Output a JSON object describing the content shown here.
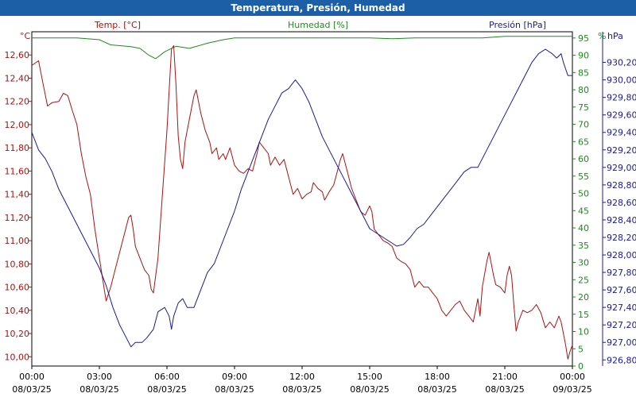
{
  "window": {
    "title": "Temperatura, Presión, Humedad"
  },
  "chart_data": {
    "type": "line",
    "title": "Temperatura, Presión, Humedad",
    "grid": true,
    "x": {
      "min_hour": 0,
      "max_hour": 24,
      "tick_hours": [
        0,
        3,
        6,
        9,
        12,
        15,
        18,
        21,
        24
      ],
      "tick_time_labels": [
        "00:00",
        "03:00",
        "06:00",
        "09:00",
        "12:00",
        "15:00",
        "18:00",
        "21:00",
        "00:00"
      ],
      "tick_date_labels": [
        "08/03/25",
        "08/03/25",
        "08/03/25",
        "08/03/25",
        "08/03/25",
        "08/03/25",
        "08/03/25",
        "08/03/25",
        "09/03/25"
      ]
    },
    "axes": {
      "temp": {
        "unit_label": "°C",
        "legend": "Temp. [°C]",
        "min": 9.92,
        "max": 12.8,
        "ticks": [
          "10,00",
          "10,20",
          "10,40",
          "10,60",
          "10,80",
          "11,00",
          "11,20",
          "11,40",
          "11,60",
          "11,80",
          "12,00",
          "12,20",
          "12,40",
          "12,60"
        ],
        "tick_values": [
          10.0,
          10.2,
          10.4,
          10.6,
          10.8,
          11.0,
          11.2,
          11.4,
          11.6,
          11.8,
          12.0,
          12.2,
          12.4,
          12.6
        ]
      },
      "humidity": {
        "unit_label": "%",
        "legend": "Humedad [%]",
        "min": 0,
        "max": 96.8,
        "ticks": [
          "0",
          "5",
          "10",
          "15",
          "20",
          "25",
          "30",
          "35",
          "40",
          "45",
          "50",
          "55",
          "60",
          "65",
          "70",
          "75",
          "80",
          "85",
          "90",
          "95",
          "%"
        ],
        "tick_values": [
          0,
          5,
          10,
          15,
          20,
          25,
          30,
          35,
          40,
          45,
          50,
          55,
          60,
          65,
          70,
          75,
          80,
          85,
          90,
          95
        ]
      },
      "pressure": {
        "unit_label": "hPa",
        "legend": "Presión [hPa]",
        "min": 926.73,
        "max": 930.55,
        "ticks": [
          "926,80",
          "927,00",
          "927,20",
          "927,40",
          "927,60",
          "927,80",
          "928,00",
          "928,20",
          "928,40",
          "928,60",
          "928,80",
          "929,00",
          "929,20",
          "929,40",
          "929,60",
          "929,80",
          "930,00",
          "930,20"
        ],
        "tick_values": [
          926.8,
          927.0,
          927.2,
          927.4,
          927.6,
          927.8,
          928.0,
          928.2,
          928.4,
          928.6,
          928.8,
          929.0,
          929.2,
          929.4,
          929.6,
          929.8,
          930.0,
          930.2
        ]
      }
    },
    "series": [
      {
        "name": "Temp. [°C]",
        "axis": "temp",
        "color": "#b01010",
        "points": [
          [
            0,
            12.51
          ],
          [
            0.3,
            12.55
          ],
          [
            0.5,
            12.35
          ],
          [
            0.7,
            12.16
          ],
          [
            0.9,
            12.19
          ],
          [
            1.2,
            12.2
          ],
          [
            1.4,
            12.27
          ],
          [
            1.6,
            12.25
          ],
          [
            1.8,
            12.12
          ],
          [
            2,
            12.0
          ],
          [
            2.2,
            11.75
          ],
          [
            2.4,
            11.55
          ],
          [
            2.6,
            11.4
          ],
          [
            2.8,
            11.1
          ],
          [
            3,
            10.85
          ],
          [
            3.2,
            10.6
          ],
          [
            3.3,
            10.48
          ],
          [
            3.5,
            10.6
          ],
          [
            3.7,
            10.75
          ],
          [
            3.9,
            10.9
          ],
          [
            4.1,
            11.05
          ],
          [
            4.3,
            11.2
          ],
          [
            4.4,
            11.22
          ],
          [
            4.5,
            11.1
          ],
          [
            4.6,
            10.95
          ],
          [
            4.8,
            10.85
          ],
          [
            5,
            10.75
          ],
          [
            5.2,
            10.7
          ],
          [
            5.3,
            10.58
          ],
          [
            5.4,
            10.55
          ],
          [
            5.6,
            10.85
          ],
          [
            5.8,
            11.4
          ],
          [
            6,
            11.95
          ],
          [
            6.1,
            12.3
          ],
          [
            6.2,
            12.65
          ],
          [
            6.3,
            12.68
          ],
          [
            6.4,
            12.35
          ],
          [
            6.5,
            11.9
          ],
          [
            6.6,
            11.7
          ],
          [
            6.7,
            11.62
          ],
          [
            6.8,
            11.85
          ],
          [
            7,
            12.05
          ],
          [
            7.2,
            12.25
          ],
          [
            7.3,
            12.3
          ],
          [
            7.5,
            12.1
          ],
          [
            7.7,
            11.95
          ],
          [
            7.9,
            11.85
          ],
          [
            8,
            11.75
          ],
          [
            8.2,
            11.8
          ],
          [
            8.3,
            11.7
          ],
          [
            8.5,
            11.75
          ],
          [
            8.6,
            11.7
          ],
          [
            8.8,
            11.8
          ],
          [
            9,
            11.65
          ],
          [
            9.2,
            11.6
          ],
          [
            9.4,
            11.58
          ],
          [
            9.6,
            11.62
          ],
          [
            9.8,
            11.6
          ],
          [
            10,
            11.75
          ],
          [
            10.1,
            11.85
          ],
          [
            10.3,
            11.8
          ],
          [
            10.5,
            11.75
          ],
          [
            10.6,
            11.65
          ],
          [
            10.8,
            11.72
          ],
          [
            11,
            11.65
          ],
          [
            11.2,
            11.7
          ],
          [
            11.4,
            11.55
          ],
          [
            11.6,
            11.4
          ],
          [
            11.8,
            11.45
          ],
          [
            12,
            11.36
          ],
          [
            12.2,
            11.4
          ],
          [
            12.4,
            11.42
          ],
          [
            12.5,
            11.5
          ],
          [
            12.7,
            11.45
          ],
          [
            12.9,
            11.42
          ],
          [
            13,
            11.35
          ],
          [
            13.2,
            11.42
          ],
          [
            13.4,
            11.48
          ],
          [
            13.5,
            11.55
          ],
          [
            13.7,
            11.7
          ],
          [
            13.8,
            11.75
          ],
          [
            14,
            11.6
          ],
          [
            14.2,
            11.45
          ],
          [
            14.4,
            11.35
          ],
          [
            14.6,
            11.25
          ],
          [
            14.8,
            11.22
          ],
          [
            15,
            11.3
          ],
          [
            15.1,
            11.25
          ],
          [
            15.2,
            11.1
          ],
          [
            15.4,
            11.05
          ],
          [
            15.6,
            11.0
          ],
          [
            15.8,
            10.98
          ],
          [
            16,
            10.95
          ],
          [
            16.2,
            10.85
          ],
          [
            16.4,
            10.82
          ],
          [
            16.6,
            10.8
          ],
          [
            16.8,
            10.75
          ],
          [
            17,
            10.6
          ],
          [
            17.2,
            10.65
          ],
          [
            17.4,
            10.6
          ],
          [
            17.6,
            10.6
          ],
          [
            17.8,
            10.55
          ],
          [
            18,
            10.5
          ],
          [
            18.2,
            10.4
          ],
          [
            18.4,
            10.35
          ],
          [
            18.6,
            10.4
          ],
          [
            18.8,
            10.45
          ],
          [
            19,
            10.48
          ],
          [
            19.2,
            10.4
          ],
          [
            19.4,
            10.35
          ],
          [
            19.6,
            10.3
          ],
          [
            19.7,
            10.4
          ],
          [
            19.8,
            10.5
          ],
          [
            19.9,
            10.35
          ],
          [
            20,
            10.6
          ],
          [
            20.2,
            10.82
          ],
          [
            20.3,
            10.9
          ],
          [
            20.5,
            10.7
          ],
          [
            20.6,
            10.62
          ],
          [
            20.8,
            10.6
          ],
          [
            21,
            10.55
          ],
          [
            21.1,
            10.7
          ],
          [
            21.2,
            10.78
          ],
          [
            21.3,
            10.7
          ],
          [
            21.4,
            10.45
          ],
          [
            21.5,
            10.22
          ],
          [
            21.6,
            10.3
          ],
          [
            21.8,
            10.4
          ],
          [
            22,
            10.38
          ],
          [
            22.2,
            10.4
          ],
          [
            22.4,
            10.45
          ],
          [
            22.6,
            10.38
          ],
          [
            22.8,
            10.25
          ],
          [
            23,
            10.3
          ],
          [
            23.2,
            10.25
          ],
          [
            23.4,
            10.35
          ],
          [
            23.5,
            10.3
          ],
          [
            23.6,
            10.2
          ],
          [
            23.7,
            10.1
          ],
          [
            23.8,
            9.98
          ],
          [
            23.9,
            10.05
          ],
          [
            24,
            10.1
          ]
        ]
      },
      {
        "name": "Humedad [%]",
        "axis": "humidity",
        "color": "#1e8a1e",
        "points": [
          [
            0,
            95
          ],
          [
            1,
            95
          ],
          [
            2,
            95
          ],
          [
            3,
            94.5
          ],
          [
            3.5,
            93
          ],
          [
            4.4,
            92.5
          ],
          [
            4.8,
            92
          ],
          [
            5.2,
            90
          ],
          [
            5.5,
            89
          ],
          [
            5.9,
            91
          ],
          [
            6.2,
            92
          ],
          [
            6.4,
            92.6
          ],
          [
            7,
            92
          ],
          [
            7.8,
            93.5
          ],
          [
            8.5,
            94.5
          ],
          [
            9,
            95
          ],
          [
            10,
            95
          ],
          [
            11,
            95
          ],
          [
            12,
            95
          ],
          [
            13,
            95
          ],
          [
            14,
            95
          ],
          [
            15,
            95
          ],
          [
            16,
            94.8
          ],
          [
            17,
            95
          ],
          [
            18,
            95
          ],
          [
            19,
            95
          ],
          [
            20,
            95
          ],
          [
            21,
            95.5
          ],
          [
            22,
            95.5
          ],
          [
            23,
            95.5
          ],
          [
            24,
            95.5
          ]
        ]
      },
      {
        "name": "Presión [hPa]",
        "axis": "pressure",
        "color": "#1818a0",
        "points": [
          [
            0,
            929.4
          ],
          [
            0.3,
            929.2
          ],
          [
            0.6,
            929.1
          ],
          [
            0.9,
            928.95
          ],
          [
            1.2,
            928.75
          ],
          [
            1.5,
            928.6
          ],
          [
            1.8,
            928.45
          ],
          [
            2.1,
            928.3
          ],
          [
            2.4,
            928.15
          ],
          [
            2.7,
            928.0
          ],
          [
            3,
            927.85
          ],
          [
            3.3,
            927.65
          ],
          [
            3.6,
            927.4
          ],
          [
            3.9,
            927.2
          ],
          [
            4.2,
            927.05
          ],
          [
            4.4,
            926.95
          ],
          [
            4.6,
            927.0
          ],
          [
            4.9,
            927.0
          ],
          [
            5.1,
            927.05
          ],
          [
            5.4,
            927.15
          ],
          [
            5.6,
            927.35
          ],
          [
            5.9,
            927.4
          ],
          [
            6.1,
            927.3
          ],
          [
            6.2,
            927.15
          ],
          [
            6.3,
            927.3
          ],
          [
            6.5,
            927.45
          ],
          [
            6.7,
            927.5
          ],
          [
            6.9,
            927.4
          ],
          [
            7.2,
            927.4
          ],
          [
            7.5,
            927.6
          ],
          [
            7.8,
            927.8
          ],
          [
            8.1,
            927.9
          ],
          [
            8.4,
            928.1
          ],
          [
            8.7,
            928.3
          ],
          [
            9,
            928.5
          ],
          [
            9.3,
            928.75
          ],
          [
            9.6,
            928.95
          ],
          [
            9.9,
            929.15
          ],
          [
            10.2,
            929.35
          ],
          [
            10.5,
            929.55
          ],
          [
            10.8,
            929.7
          ],
          [
            11.1,
            929.85
          ],
          [
            11.4,
            929.9
          ],
          [
            11.7,
            930.0
          ],
          [
            12,
            929.9
          ],
          [
            12.3,
            929.75
          ],
          [
            12.6,
            929.55
          ],
          [
            12.9,
            929.35
          ],
          [
            13.2,
            929.2
          ],
          [
            13.5,
            929.05
          ],
          [
            13.8,
            928.9
          ],
          [
            14.1,
            928.75
          ],
          [
            14.4,
            928.6
          ],
          [
            14.7,
            928.45
          ],
          [
            15,
            928.3
          ],
          [
            15.3,
            928.25
          ],
          [
            15.6,
            928.2
          ],
          [
            15.9,
            928.15
          ],
          [
            16.2,
            928.1
          ],
          [
            16.5,
            928.12
          ],
          [
            16.8,
            928.2
          ],
          [
            17.1,
            928.3
          ],
          [
            17.4,
            928.35
          ],
          [
            17.7,
            928.45
          ],
          [
            18,
            928.55
          ],
          [
            18.3,
            928.65
          ],
          [
            18.6,
            928.75
          ],
          [
            18.9,
            928.85
          ],
          [
            19.2,
            928.95
          ],
          [
            19.5,
            929.0
          ],
          [
            19.8,
            929.0
          ],
          [
            20.1,
            929.15
          ],
          [
            20.4,
            929.3
          ],
          [
            20.7,
            929.45
          ],
          [
            21,
            929.6
          ],
          [
            21.3,
            929.75
          ],
          [
            21.6,
            929.9
          ],
          [
            21.9,
            930.05
          ],
          [
            22.2,
            930.2
          ],
          [
            22.5,
            930.3
          ],
          [
            22.8,
            930.35
          ],
          [
            23.1,
            930.3
          ],
          [
            23.3,
            930.25
          ],
          [
            23.5,
            930.3
          ],
          [
            23.6,
            930.2
          ],
          [
            23.8,
            930.05
          ],
          [
            24,
            930.05
          ]
        ]
      }
    ]
  }
}
